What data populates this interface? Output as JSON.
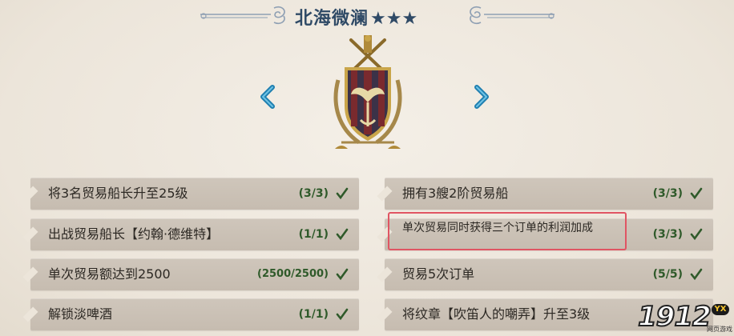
{
  "header": {
    "title": "北海微澜",
    "stars": "★★★"
  },
  "navigation": {
    "prev_icon": "chevron-left-icon",
    "next_icon": "chevron-right-icon"
  },
  "emblem": {
    "icon": "crest-emblem-icon"
  },
  "tasks_left": [
    {
      "label": "将3名贸易船长升至25级",
      "progress": "(3/3)"
    },
    {
      "label": "出战贸易船长【约翰·德维特】",
      "progress": "(1/1)"
    },
    {
      "label": "单次贸易额达到2500",
      "progress": "(2500/2500)"
    },
    {
      "label": "解锁淡啤酒",
      "progress": "(1/1)"
    }
  ],
  "tasks_right": [
    {
      "label": "拥有3艘2阶贸易船",
      "progress": "(3/3)"
    },
    {
      "label": "单次贸易同时获得三个订单的利润加成",
      "progress": "(3/3)"
    },
    {
      "label": "贸易5次订单",
      "progress": "(5/5)"
    },
    {
      "label": "将纹章【吹笛人的嘲弄】升至3级",
      "progress": ""
    }
  ],
  "colors": {
    "title": "#2f4a66",
    "accent_arrow": "#1f7fb0",
    "check": "#2f5a2a",
    "highlight": "#e05563"
  },
  "watermark": {
    "number": "1912",
    "badge": "YX",
    "subtitle": "网页游戏"
  }
}
